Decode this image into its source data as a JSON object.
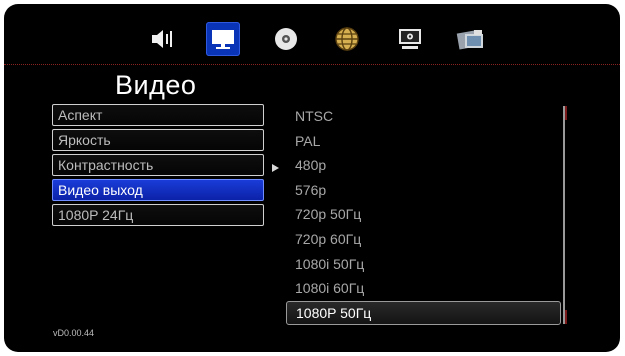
{
  "tabs": [
    {
      "icon": "speaker-icon"
    },
    {
      "icon": "monitor-icon"
    },
    {
      "icon": "disc-icon"
    },
    {
      "icon": "globe-icon"
    },
    {
      "icon": "computer-settings-icon"
    },
    {
      "icon": "photo-icon"
    }
  ],
  "page": {
    "title": "Видео",
    "version": "vD0.00.44"
  },
  "menu": {
    "items": [
      {
        "label": "Аспект"
      },
      {
        "label": "Яркость"
      },
      {
        "label": "Контрастность"
      },
      {
        "label": "Видео выход"
      },
      {
        "label": "1080P 24Гц"
      }
    ],
    "selected_index": 3
  },
  "options": {
    "items": [
      {
        "label": "NTSC"
      },
      {
        "label": "PAL"
      },
      {
        "label": "480p"
      },
      {
        "label": "576p"
      },
      {
        "label": "720p 50Гц"
      },
      {
        "label": "720p 60Гц"
      },
      {
        "label": "1080i 50Гц"
      },
      {
        "label": "1080i 60Гц"
      },
      {
        "label": "1080P 50Гц"
      }
    ],
    "current_index": 2,
    "highlighted_index": 8
  },
  "colors": {
    "selection_blue": "#1a3cd8",
    "accent_red": "#8a2222",
    "text_gray": "#a8a8a8"
  }
}
